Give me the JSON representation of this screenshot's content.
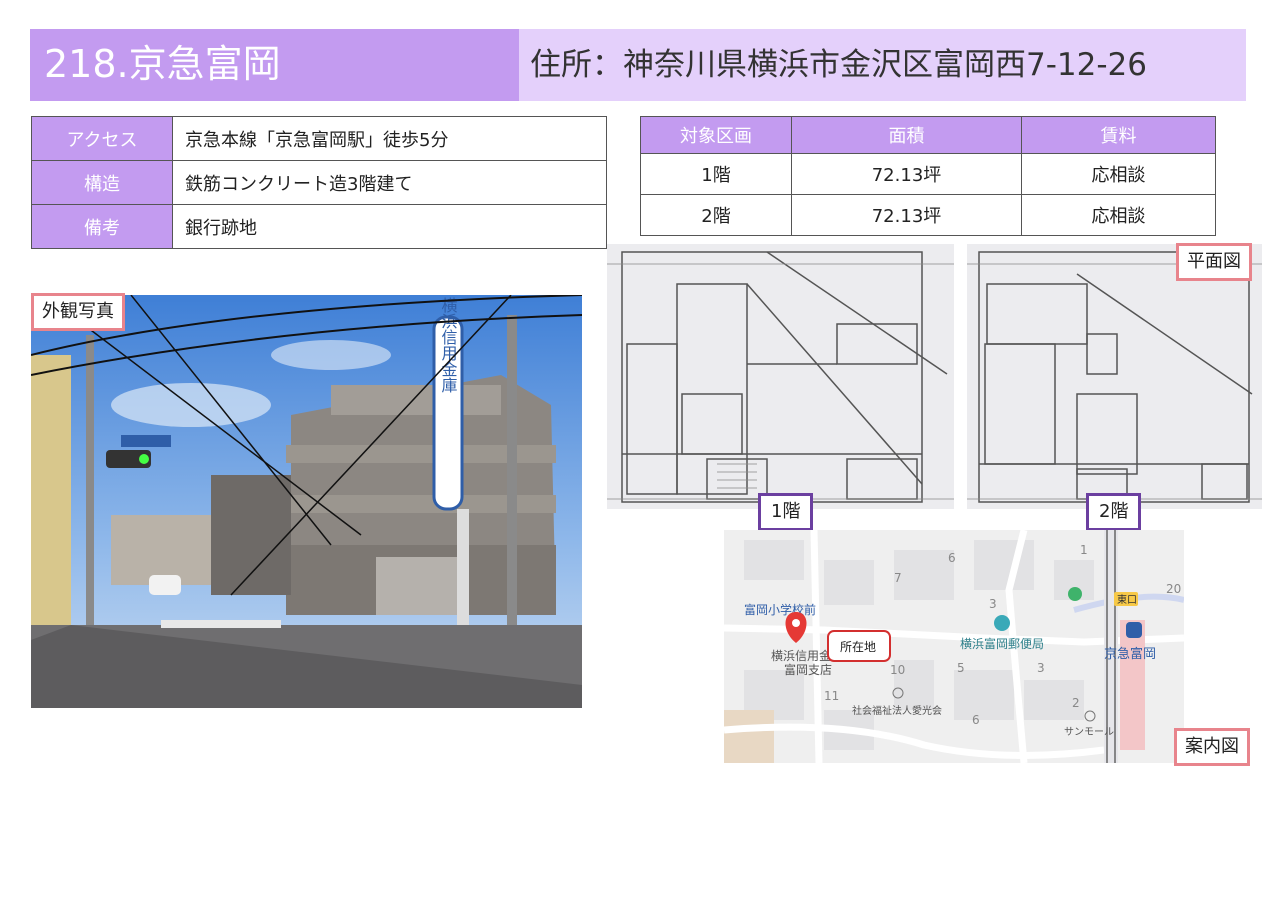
{
  "header": {
    "title": "218.京急富岡",
    "address": "住所：神奈川県横浜市金沢区富岡西7-12-26"
  },
  "info": [
    {
      "key": "アクセス",
      "value": "京急本線「京急富岡駅」徒歩5分"
    },
    {
      "key": "構造",
      "value": "鉄筋コンクリート造3階建て"
    },
    {
      "key": "備考",
      "value": "銀行跡地"
    }
  ],
  "floors": {
    "headers": [
      "対象区画",
      "面積",
      "賃料"
    ],
    "rows": [
      [
        "1階",
        "72.13坪",
        "応相談"
      ],
      [
        "2階",
        "72.13坪",
        "応相談"
      ]
    ]
  },
  "labels": {
    "photo": "外観写真",
    "plan": "平面図",
    "floor1": "1階",
    "floor2": "2階",
    "map": "案内図",
    "location": "所在地"
  },
  "photo": {
    "sign": "横浜信用金庫",
    "street_sign": "富岡小学校前"
  },
  "map_labels": {
    "school": "富岡小学校前",
    "bank": "横浜信用金庫",
    "branch": "富岡支店",
    "post": "横浜富岡郵便局",
    "welfare": "社会福祉法人愛光会",
    "mall": "サンモール",
    "station": "京急富岡",
    "east_exit": "東口",
    "n6": "6",
    "n7": "7",
    "n1": "1",
    "n20": "20",
    "n3": "3",
    "n10": "10",
    "n5": "5",
    "n3b": "3",
    "n11": "11",
    "n6b": "6",
    "n2": "2"
  },
  "colors": {
    "accent": "#c39bf0",
    "accent_light": "#e4d0fb",
    "tag_border": "#e8848c",
    "tag_purple": "#6b3fa0"
  }
}
